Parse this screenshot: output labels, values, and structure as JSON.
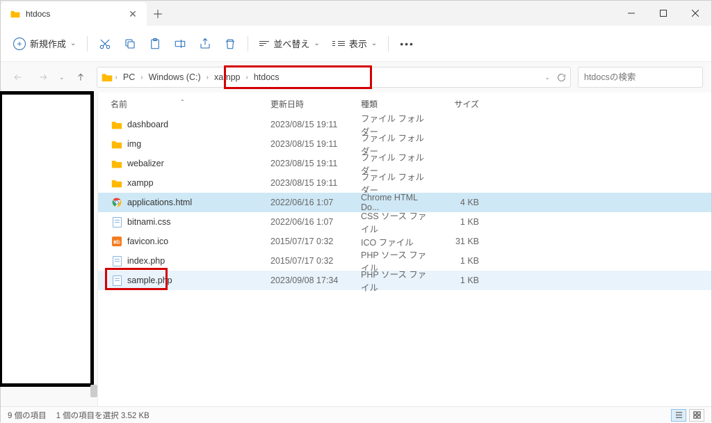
{
  "tab": {
    "title": "htdocs"
  },
  "toolbar": {
    "new_label": "新規作成",
    "sort_label": "並べ替え",
    "view_label": "表示"
  },
  "breadcrumb": {
    "items": [
      "PC",
      "Windows (C:)",
      "xampp",
      "htdocs"
    ]
  },
  "search": {
    "placeholder": "htdocsの検索"
  },
  "columns": {
    "name": "名前",
    "date": "更新日時",
    "type": "種類",
    "size": "サイズ"
  },
  "rows": [
    {
      "icon": "folder",
      "name": "dashboard",
      "date": "2023/08/15 19:11",
      "type": "ファイル フォルダー",
      "size": "",
      "state": ""
    },
    {
      "icon": "folder",
      "name": "img",
      "date": "2023/08/15 19:11",
      "type": "ファイル フォルダー",
      "size": "",
      "state": ""
    },
    {
      "icon": "folder",
      "name": "webalizer",
      "date": "2023/08/15 19:11",
      "type": "ファイル フォルダー",
      "size": "",
      "state": ""
    },
    {
      "icon": "folder",
      "name": "xampp",
      "date": "2023/08/15 19:11",
      "type": "ファイル フォルダー",
      "size": "",
      "state": ""
    },
    {
      "icon": "chrome",
      "name": "applications.html",
      "date": "2022/06/16 1:07",
      "type": "Chrome HTML Do...",
      "size": "4 KB",
      "state": "sel"
    },
    {
      "icon": "file",
      "name": "bitnami.css",
      "date": "2022/06/16 1:07",
      "type": "CSS ソース ファイル",
      "size": "1 KB",
      "state": ""
    },
    {
      "icon": "xampp",
      "name": "favicon.ico",
      "date": "2015/07/17 0:32",
      "type": "ICO ファイル",
      "size": "31 KB",
      "state": ""
    },
    {
      "icon": "file",
      "name": "index.php",
      "date": "2015/07/17 0:32",
      "type": "PHP ソース ファイル",
      "size": "1 KB",
      "state": ""
    },
    {
      "icon": "file",
      "name": "sample.php",
      "date": "2023/09/08 17:34",
      "type": "PHP ソース ファイル",
      "size": "1 KB",
      "state": "hover",
      "highlight": true
    }
  ],
  "status": {
    "count": "9 個の項目",
    "selected": "1 個の項目を選択 3.52 KB"
  }
}
